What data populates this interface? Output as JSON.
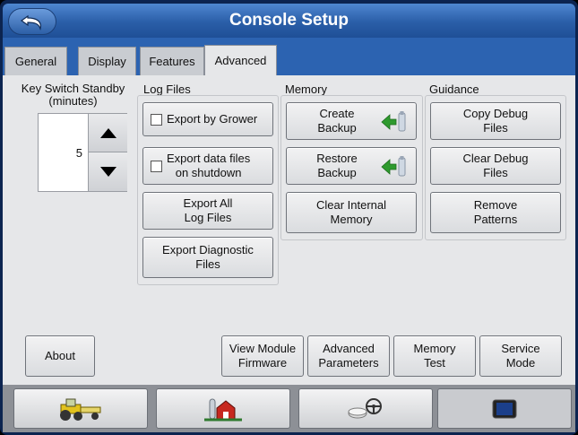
{
  "window": {
    "title": "Console Setup"
  },
  "tabs": [
    {
      "label": "General"
    },
    {
      "label": "Display"
    },
    {
      "label": "Features"
    },
    {
      "label": "Advanced",
      "active": true
    }
  ],
  "key_switch": {
    "label": "Key Switch Standby\n(minutes)",
    "value": "5"
  },
  "log_files": {
    "label": "Log Files",
    "export_by_grower": "Export by Grower",
    "export_on_shutdown": "Export data files\non shutdown",
    "export_all": "Export All\nLog Files",
    "export_diagnostic": "Export Diagnostic\nFiles"
  },
  "memory": {
    "label": "Memory",
    "create_backup": "Create\nBackup",
    "restore_backup": "Restore\nBackup",
    "clear_internal": "Clear Internal\nMemory"
  },
  "guidance": {
    "label": "Guidance",
    "copy_debug": "Copy Debug\nFiles",
    "clear_debug": "Clear Debug\nFiles",
    "remove_patterns": "Remove\nPatterns"
  },
  "bottom_buttons": {
    "about": "About",
    "view_module_firmware": "View Module\nFirmware",
    "advanced_parameters": "Advanced\nParameters",
    "memory_test": "Memory\nTest",
    "service_mode": "Service\nMode"
  },
  "nav": [
    {
      "icon": "tractor-icon"
    },
    {
      "icon": "farm-icon"
    },
    {
      "icon": "guidance-steering-icon"
    },
    {
      "icon": "screen-icon",
      "active": true
    }
  ],
  "colors": {
    "title_bar": "#2a5ea8",
    "tab_bar": "#2c63b1",
    "panel": "#e6e7e9",
    "arrow_green": "#2e9a2e"
  }
}
